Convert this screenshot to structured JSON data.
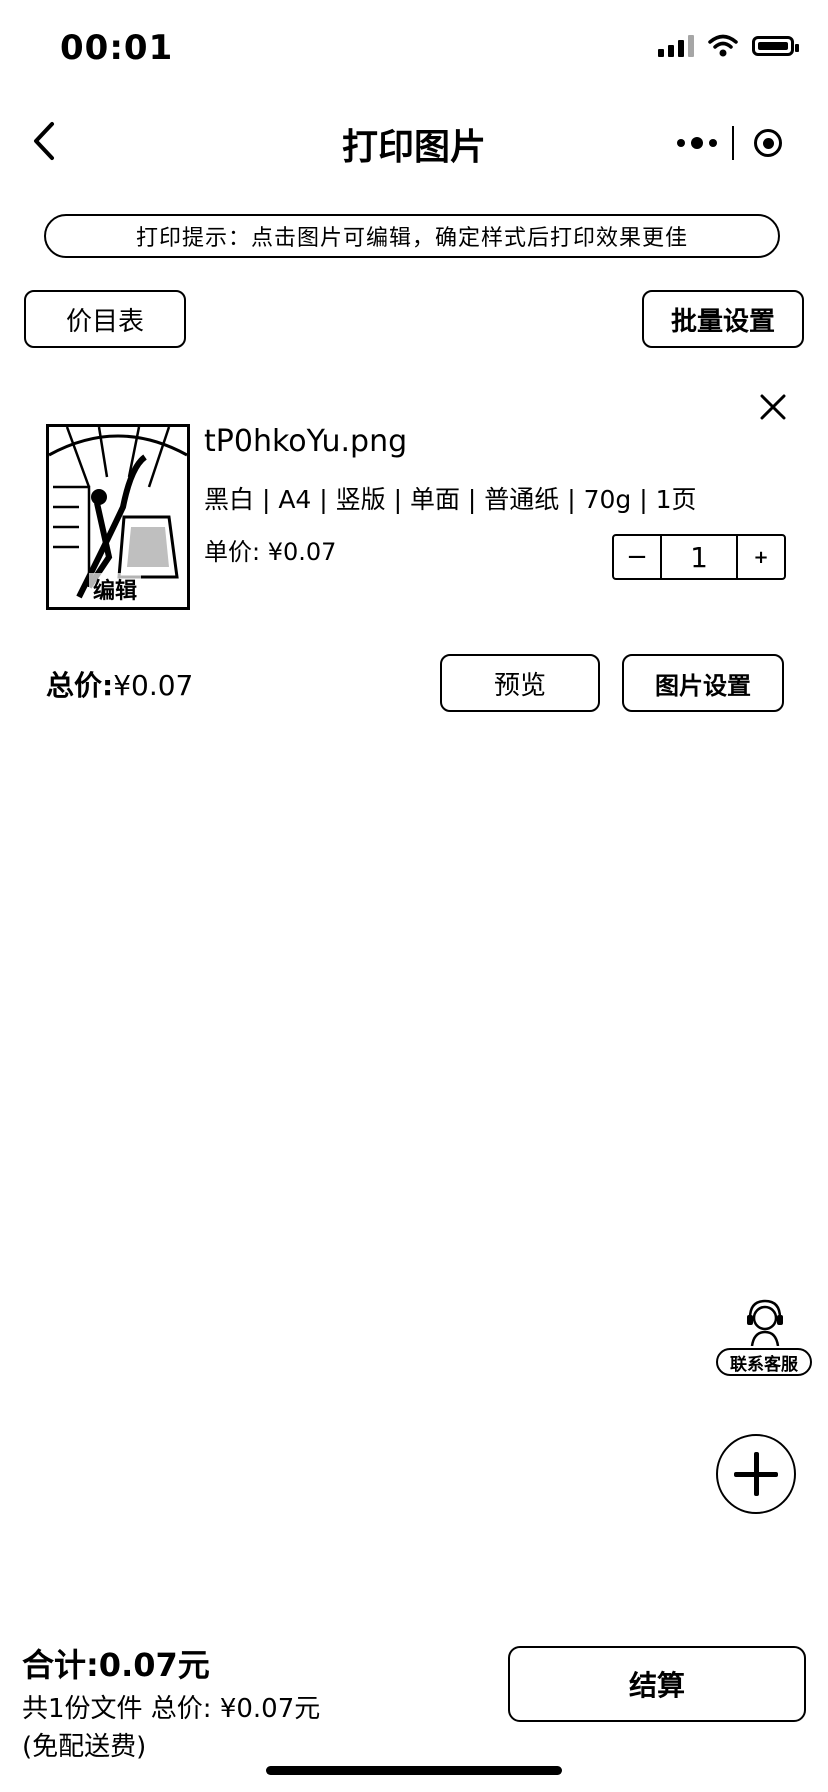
{
  "status_bar": {
    "time": "00:01"
  },
  "nav": {
    "title": "打印图片"
  },
  "tip": {
    "text": "打印提示：点击图片可编辑，确定样式后打印效果更佳"
  },
  "toolbar": {
    "price_table": "价目表",
    "batch_settings": "批量设置"
  },
  "item": {
    "filename": "tP0hkoYu.png",
    "spec": "黑白 | A4 | 竖版 | 单面 | 普通纸 | 70g | 1页",
    "unit_price": "单价: ¥0.07",
    "edit_label": "编辑",
    "quantity": "1",
    "minus_label": "−",
    "plus_label": "+",
    "total_label": "总价:",
    "total_value": "¥0.07",
    "preview_label": "预览",
    "image_settings_label": "图片设置"
  },
  "floating": {
    "customer_service": "联系客服"
  },
  "footer": {
    "sum": "合计:0.07元",
    "summary": "共1份文件   总价: ¥0.07元",
    "shipping_note": "(免配送费)",
    "checkout": "结算"
  }
}
